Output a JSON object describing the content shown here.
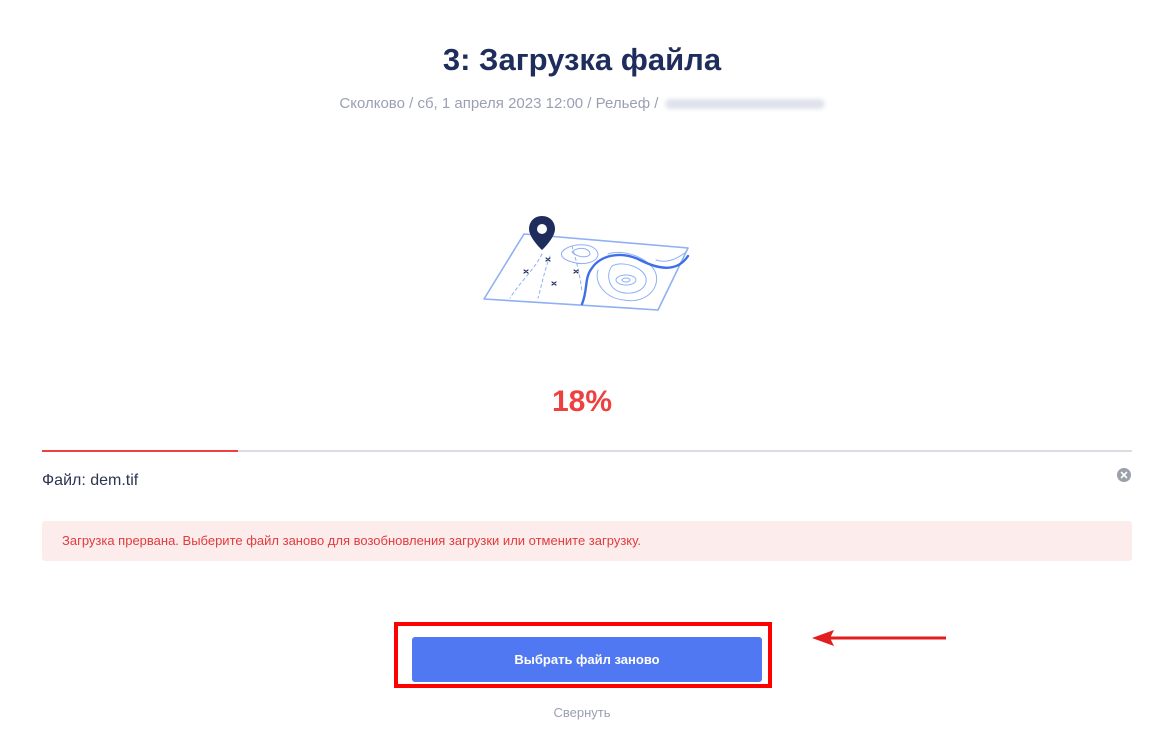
{
  "header": {
    "title": "3: Загрузка файла",
    "meta": "Сколково / сб, 1 апреля 2023 12:00 / Рельеф /",
    "meta_redacted": true
  },
  "illustration": {
    "icon": "map-pin-icon",
    "pin_color": "#1f2d5c",
    "map_line_color": "#8fb0f5",
    "river_color": "#3f6fe6"
  },
  "upload": {
    "percent_label": "18%",
    "progress": 0.18,
    "progress_color": "#ef4040",
    "file_label": "Файл: dem.tif",
    "cancel_icon": "close-circle-icon"
  },
  "alert": {
    "message": "Загрузка прервана. Выберите файл заново для возобновления загрузки или отмените загрузку.",
    "color": "#e23b3b",
    "background": "#fdecec"
  },
  "actions": {
    "reselect_label": "Выбрать файл заново",
    "collapse_label": "Свернуть",
    "primary_color": "#5078f2"
  },
  "annotation": {
    "highlight_color": "#ff0000",
    "arrow_icon": "arrow-left-icon"
  }
}
